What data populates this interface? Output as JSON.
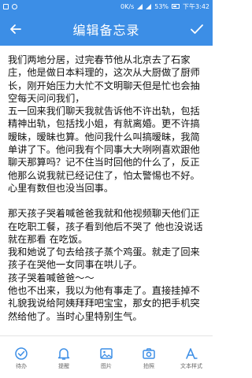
{
  "status": {
    "network": "0K/s",
    "battery": "53%",
    "time": "下午3:42"
  },
  "header": {
    "title": "编辑备忘录"
  },
  "note": {
    "paragraphs": [
      "我们两地分居，过完春节他从北京去了石家庄，他是做日本料理的，这次从大厨做了厨师长，刚开始压力大忙不文明聊天但是忙也会抽空每天问问我们，",
      "五一回来我们聊天我就告诉他不许出轨，包括精神出轨，包括找小姐，有就离婚。更不许搞暧昧，暧昧也算。他问我什么叫搞暧昧，我简单讲了下。他问我有个同事大大咧咧喜欢跟他聊天那算吗？记不住当时回他的什么了，反正他那么说我就已经记住了，怕太警惕也不好。心里有数但也没当回事。",
      "",
      "那天孩子哭着喊爸爸我就和他视频聊天他们正在吃职工餐，孩子看到他后不哭了 他也没说话就在那看 在吃饭。",
      "我和她说了句去给孩子蒸个鸡蛋。就走了回来孩子在哭他一女同事在哄儿子。",
      "孩子哭着喊爸爸～～",
      "他也不出来，我以为他有事走了。直接挂掉不礼貌我说给阿姨拜拜吧宝宝，那女的把手机突然给他了。当时心里特别生气。"
    ]
  },
  "toolbar": {
    "items": [
      {
        "label": "待办",
        "icon": "checklist-icon"
      },
      {
        "label": "提醒",
        "icon": "bell-icon"
      },
      {
        "label": "图片",
        "icon": "image-icon"
      },
      {
        "label": "拍照",
        "icon": "camera-icon"
      },
      {
        "label": "文本样式",
        "icon": "text-style-icon"
      }
    ]
  },
  "colors": {
    "primary": "#3c8ee6",
    "icon": "#3c8ee6"
  }
}
